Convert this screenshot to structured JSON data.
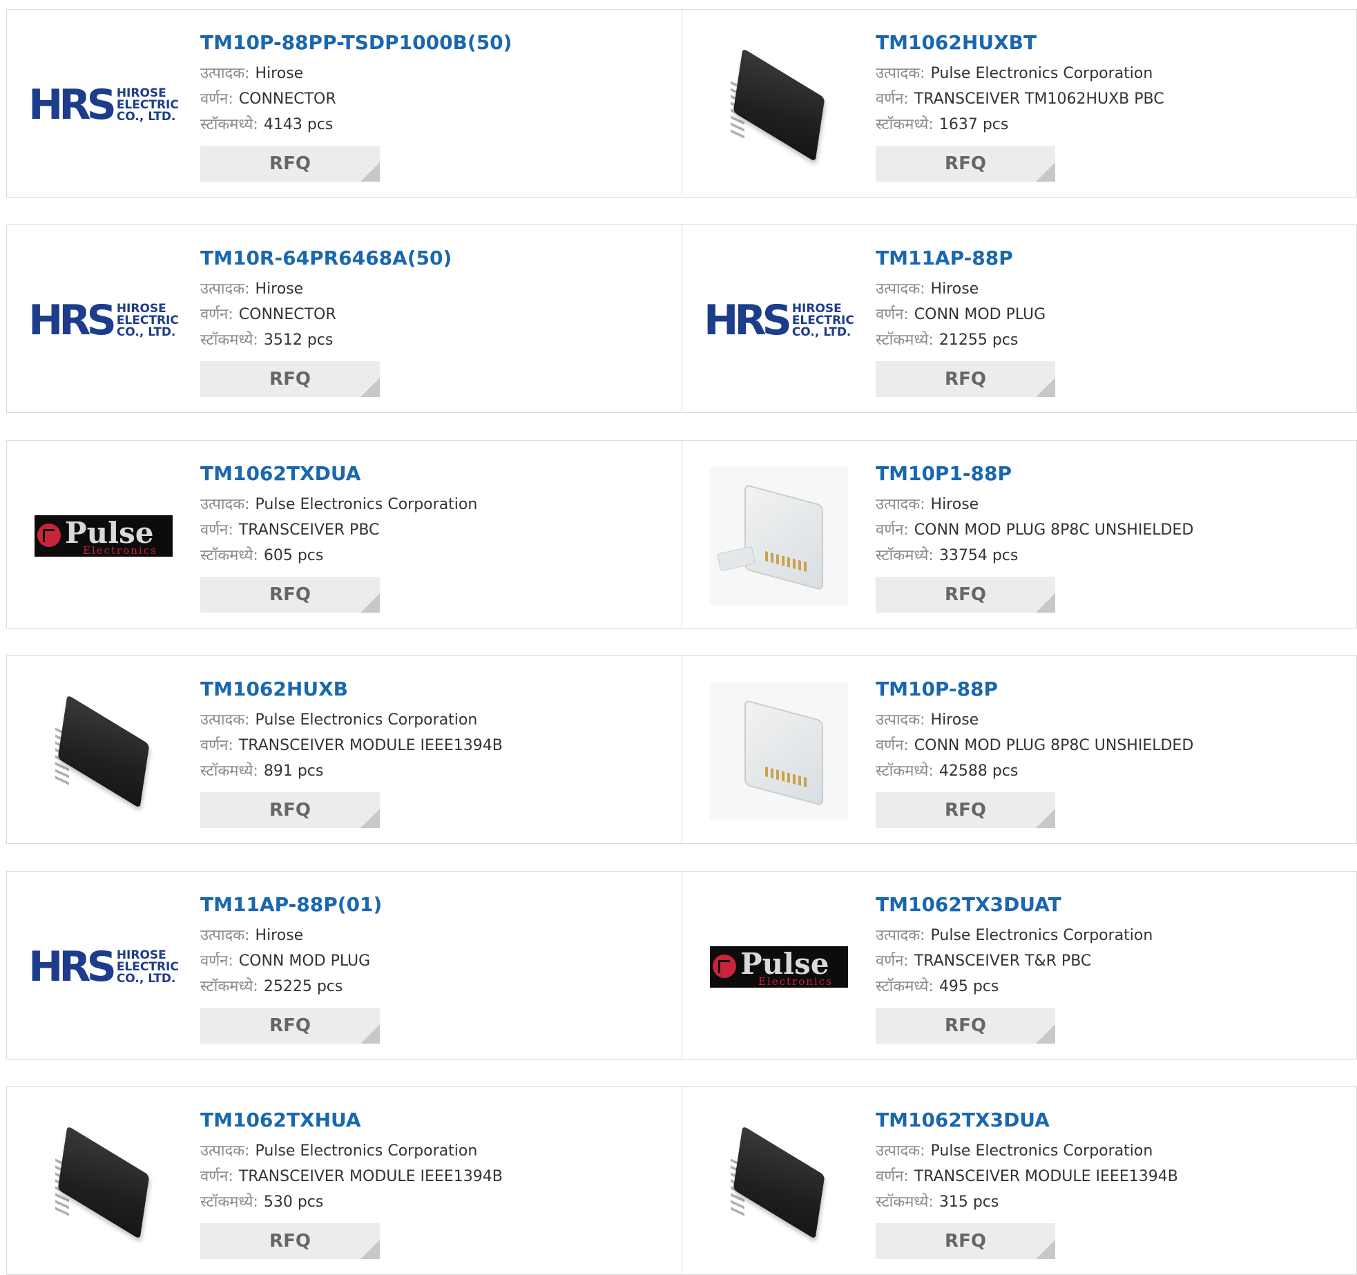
{
  "labels": {
    "manufacturer": "उत्पादक:",
    "description": "वर्णन:",
    "stock": "स्टॉकमध्ये:",
    "rfq": "RFQ"
  },
  "products": [
    {
      "part": "TM10P-88PP-TSDP1000B(50)",
      "manufacturer": "Hirose",
      "description": "CONNECTOR",
      "stock": "4143 pcs",
      "image": "hrs-logo"
    },
    {
      "part": "TM1062HUXBT",
      "manufacturer": "Pulse Electronics Corporation",
      "description": "TRANSCEIVER TM1062HUXB PBC",
      "stock": "1637 pcs",
      "image": "chip"
    },
    {
      "part": "TM10R-64PR6468A(50)",
      "manufacturer": "Hirose",
      "description": "CONNECTOR",
      "stock": "3512 pcs",
      "image": "hrs-logo"
    },
    {
      "part": "TM11AP-88P",
      "manufacturer": "Hirose",
      "description": "CONN MOD PLUG",
      "stock": "21255 pcs",
      "image": "hrs-logo"
    },
    {
      "part": "TM1062TXDUA",
      "manufacturer": "Pulse Electronics Corporation",
      "description": "TRANSCEIVER PBC",
      "stock": "605 pcs",
      "image": "pulse-logo"
    },
    {
      "part": "TM10P1-88P",
      "manufacturer": "Hirose",
      "description": "CONN MOD PLUG 8P8C UNSHIELDED",
      "stock": "33754 pcs",
      "image": "plug-with-cover"
    },
    {
      "part": "TM1062HUXB",
      "manufacturer": "Pulse Electronics Corporation",
      "description": "TRANSCEIVER MODULE IEEE1394B",
      "stock": "891 pcs",
      "image": "chip"
    },
    {
      "part": "TM10P-88P",
      "manufacturer": "Hirose",
      "description": "CONN MOD PLUG 8P8C UNSHIELDED",
      "stock": "42588 pcs",
      "image": "plug"
    },
    {
      "part": "TM11AP-88P(01)",
      "manufacturer": "Hirose",
      "description": "CONN MOD PLUG",
      "stock": "25225 pcs",
      "image": "hrs-logo"
    },
    {
      "part": "TM1062TX3DUAT",
      "manufacturer": "Pulse Electronics Corporation",
      "description": "TRANSCEIVER T&R PBC",
      "stock": "495 pcs",
      "image": "pulse-logo"
    },
    {
      "part": "TM1062TXHUA",
      "manufacturer": "Pulse Electronics Corporation",
      "description": "TRANSCEIVER MODULE IEEE1394B",
      "stock": "530 pcs",
      "image": "chip"
    },
    {
      "part": "TM1062TX3DUA",
      "manufacturer": "Pulse Electronics Corporation",
      "description": "TRANSCEIVER MODULE IEEE1394B",
      "stock": "315 pcs",
      "image": "chip"
    }
  ],
  "logos": {
    "hrs_mark": "HRS",
    "hrs_line1": "HIROSE",
    "hrs_line2": "ELECTRIC",
    "hrs_line3": "CO., LTD.",
    "pulse_word": "Pulse",
    "pulse_sub": "Electronics"
  },
  "colors": {
    "title": "#1a67b0",
    "label": "#8a8a8a",
    "rfq_bg": "#ececec",
    "border": "#d9d9d9"
  }
}
